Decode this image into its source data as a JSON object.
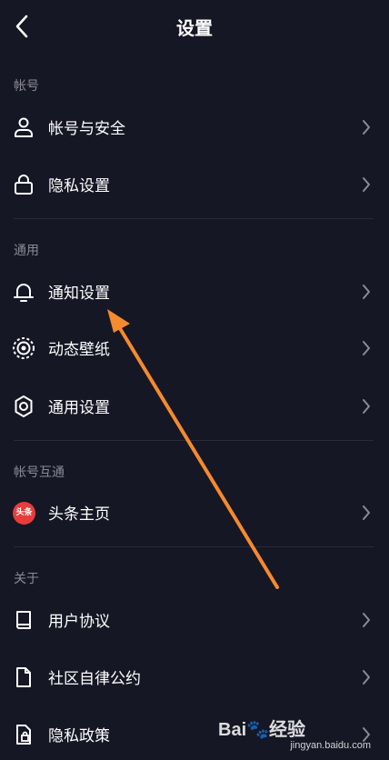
{
  "header": {
    "title": "设置"
  },
  "sections": [
    {
      "label": "帐号",
      "items": [
        {
          "label": "帐号与安全",
          "icon": "user-icon"
        },
        {
          "label": "隐私设置",
          "icon": "lock-icon"
        }
      ]
    },
    {
      "label": "通用",
      "items": [
        {
          "label": "通知设置",
          "icon": "bell-icon"
        },
        {
          "label": "动态壁纸",
          "icon": "wallpaper-icon"
        },
        {
          "label": "通用设置",
          "icon": "gear-icon"
        }
      ]
    },
    {
      "label": "帐号互通",
      "items": [
        {
          "label": "头条主页",
          "icon": "toutiao-icon",
          "badge": "头条"
        }
      ]
    },
    {
      "label": "关于",
      "items": [
        {
          "label": "用户协议",
          "icon": "book-icon"
        },
        {
          "label": "社区自律公约",
          "icon": "document-icon"
        },
        {
          "label": "隐私政策",
          "icon": "privacy-document-icon"
        }
      ]
    }
  ],
  "watermark": {
    "brand_left": "Bai",
    "brand_right": "经验",
    "url": "jingyan.baidu.com"
  },
  "colors": {
    "background": "#161724",
    "annotation_arrow": "#f58a2e",
    "toutiao_badge": "#e83c3c"
  }
}
